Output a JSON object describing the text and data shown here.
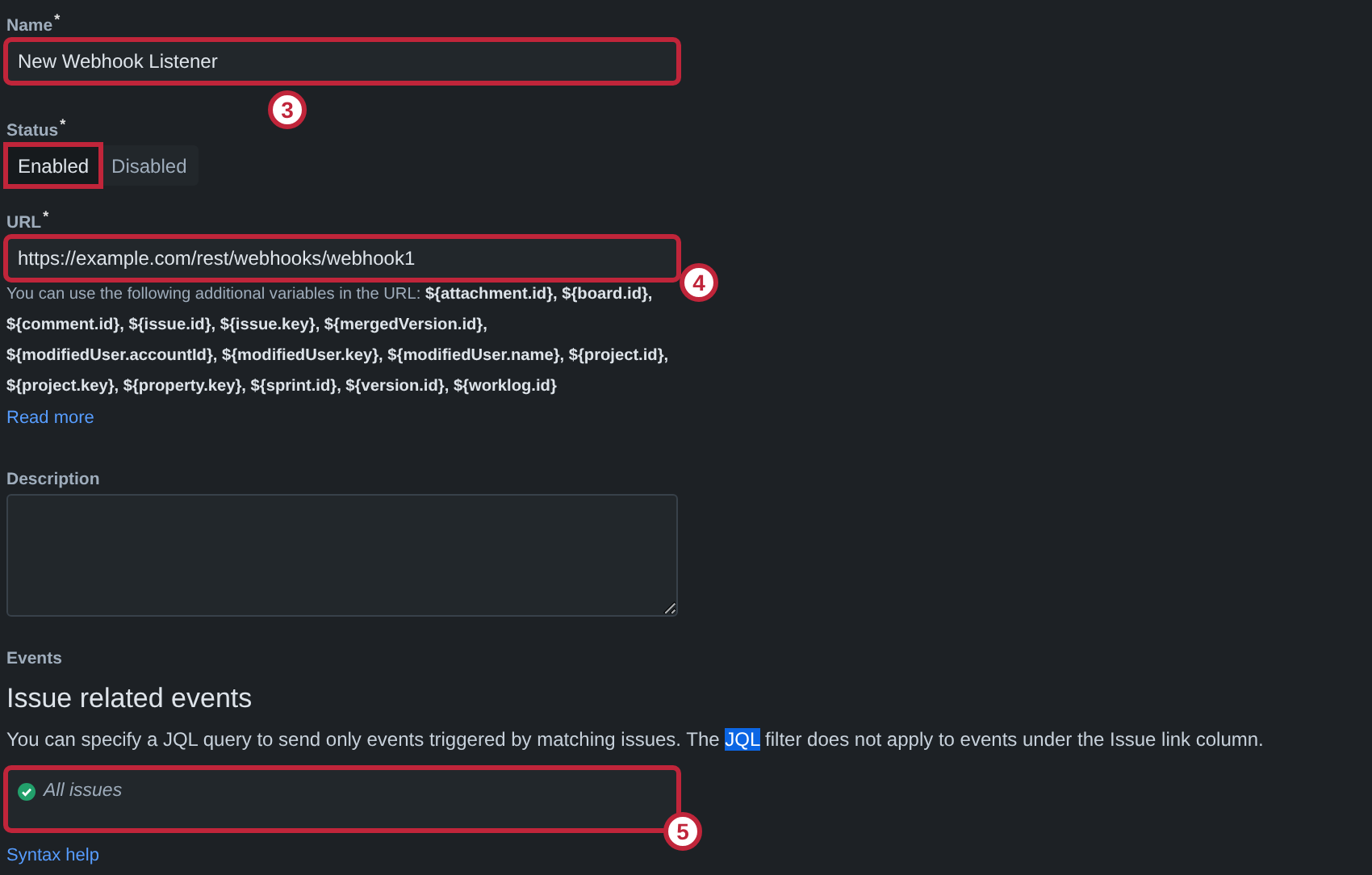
{
  "name_field": {
    "label": "Name",
    "required_mark": "*",
    "value": "New Webhook Listener",
    "highlighted": true,
    "callout": "3"
  },
  "status": {
    "label": "Status",
    "required_mark": "*",
    "options": [
      {
        "label": "Enabled",
        "selected": true,
        "highlighted": true
      },
      {
        "label": "Disabled",
        "selected": false,
        "highlighted": false
      }
    ]
  },
  "url_field": {
    "label": "URL",
    "required_mark": "*",
    "value": "https://example.com/rest/webhooks/webhook1",
    "highlighted": true,
    "callout": "4",
    "help": "You can use the following additional variables in the URL: **${attachment.id}, ${board.id}, ${comment.id}, ${issue.id}, ${issue.key}, ${mergedVersion.id}, ${modifiedUser.accountId}, ${modifiedUser.key}, ${modifiedUser.name}, ${project.id}, ${project.key}, ${property.key}, ${sprint.id}, ${version.id}, ${worklog.id}**",
    "link": "Read more"
  },
  "description_field": {
    "label": "Description"
  },
  "events": {
    "label": "Events",
    "heading": "Issue related events",
    "text_parts": [
      {
        "text": "You can specify a JQL query to send only events triggered by matching issues. The ",
        "selected": false
      },
      {
        "text": "JQL",
        "selected": true
      },
      {
        "text": " filter does not apply to events under the Issue link column.",
        "selected": false
      }
    ],
    "jql_field": {
      "value": "All issues",
      "valid": true,
      "highlighted": true,
      "callout": "5"
    },
    "link": "Syntax help"
  }
}
